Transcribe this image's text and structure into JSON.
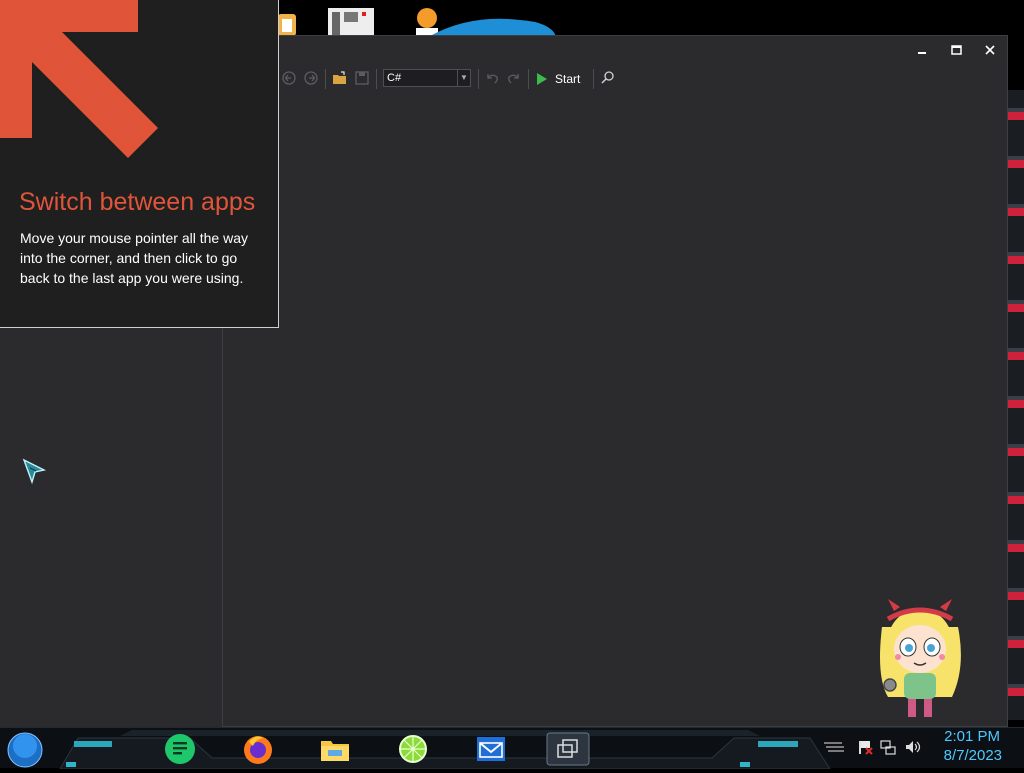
{
  "tip": {
    "title": "Switch between apps",
    "body": "Move your mouse pointer all the way into the corner, and then click to go back to the last app you were using."
  },
  "toolbar": {
    "language": "C#",
    "start_label": "Start",
    "icons": [
      "back-icon",
      "forward-icon",
      "open-folder-icon",
      "save-icon",
      "undo-icon",
      "redo-icon",
      "play-icon",
      "search-icon"
    ]
  },
  "window": {
    "controls": [
      "minimize-icon",
      "maximize-icon",
      "close-icon"
    ]
  },
  "taskbar": {
    "apps": [
      "start-orb-icon",
      "notes-app-icon",
      "firefox-icon",
      "file-explorer-icon",
      "lime-app-icon",
      "mail-icon",
      "task-view-icon"
    ],
    "tray": [
      "keyboard-icon",
      "flag-icon",
      "network-icon",
      "volume-icon"
    ],
    "time": "2:01 PM",
    "date": "8/7/2023"
  },
  "colors": {
    "accent_orange": "#e0553a",
    "window_bg": "#2b2b2e",
    "clock_blue": "#4ec9ff",
    "play_green": "#3dbb4a"
  }
}
